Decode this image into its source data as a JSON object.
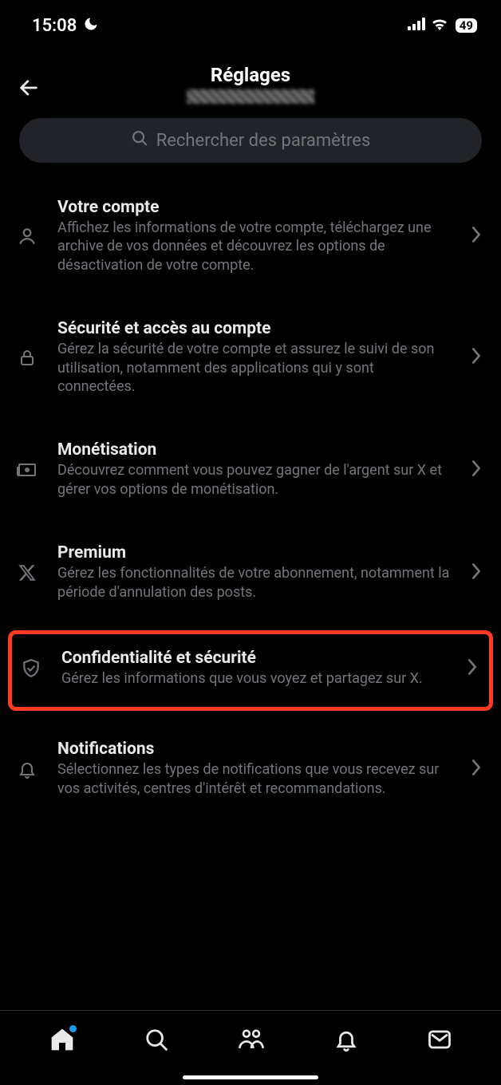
{
  "status": {
    "time": "15:08",
    "battery": "49"
  },
  "header": {
    "title": "Réglages"
  },
  "search": {
    "placeholder": "Rechercher des paramètres"
  },
  "items": {
    "account": {
      "title": "Votre compte",
      "desc": "Affichez les informations de votre compte, téléchargez une archive de vos données et découvrez les options de désactivation de votre compte."
    },
    "security": {
      "title": "Sécurité et accès au compte",
      "desc": "Gérez la sécurité de votre compte et assurez le suivi de son utilisation, notamment des applications qui y sont connectées."
    },
    "monetization": {
      "title": "Monétisation",
      "desc": "Découvrez comment vous pouvez gagner de l'argent sur X et gérer vos options de monétisation."
    },
    "premium": {
      "title": "Premium",
      "desc": "Gérez les fonctionnalités de votre abonnement, notamment la période d'annulation des posts."
    },
    "privacy": {
      "title": "Confidentialité et sécurité",
      "desc": "Gérez les informations que vous voyez et partagez sur X."
    },
    "notifications": {
      "title": "Notifications",
      "desc": "Sélectionnez les types de notifications que vous recevez sur vos activités, centres d'intérêt et recommandations."
    }
  }
}
